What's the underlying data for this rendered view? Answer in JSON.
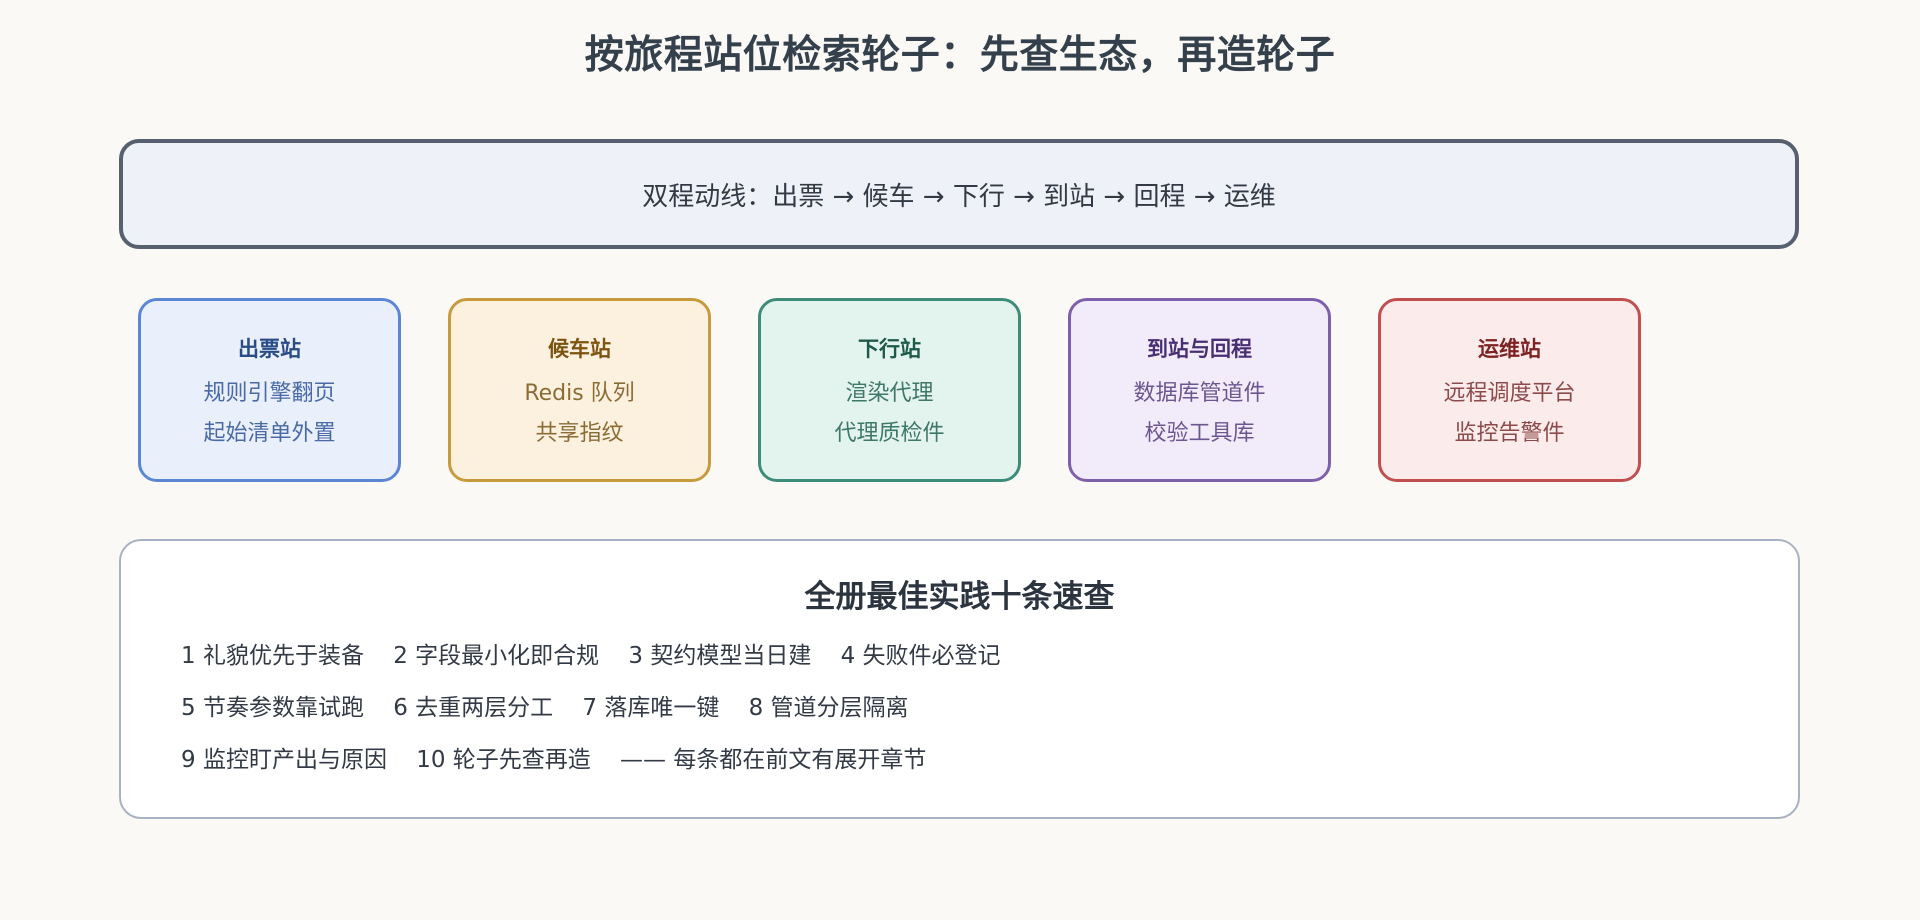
{
  "title": "按旅程站位检索轮子：先查生态，再造轮子",
  "flow": {
    "text": "双程动线：出票 → 候车 → 下行 → 到站 → 回程 → 运维"
  },
  "stations": [
    {
      "title": "出票站",
      "lines": [
        "规则引擎翻页",
        "起始清单外置"
      ],
      "border": "#5b86d4",
      "fill": "#e9f0fc"
    },
    {
      "title": "候车站",
      "lines": [
        "Redis 队列",
        "共享指纹"
      ],
      "border": "#c79a3c",
      "fill": "#fcf1df"
    },
    {
      "title": "下行站",
      "lines": [
        "渲染代理",
        "代理质检件"
      ],
      "border": "#3d8c7a",
      "fill": "#e3f3ee"
    },
    {
      "title": "到站与回程",
      "lines": [
        "数据库管道件",
        "校验工具库"
      ],
      "border": "#7e60aa",
      "fill": "#f2ecfa"
    },
    {
      "title": "运维站",
      "lines": [
        "远程调度平台",
        "监控告警件"
      ],
      "border": "#c14f4f",
      "fill": "#fcebeb"
    }
  ],
  "practices": {
    "title": "全册最佳实践十条速查",
    "lines": [
      "1 礼貌优先于装备    2 字段最小化即合规    3 契约模型当日建    4 失败件必登记",
      "5 节奏参数靠试跑    6 去重两层分工    7 落库唯一键    8 管道分层隔离",
      "9 监控盯产出与原因    10 轮子先查再造    —— 每条都在前文有展开章节"
    ]
  }
}
